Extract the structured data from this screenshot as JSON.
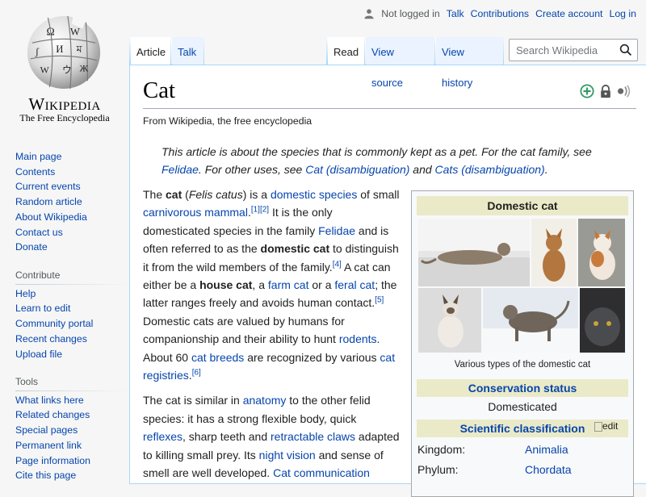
{
  "branding": {
    "wordmark": "Wikipedia",
    "tagline": "The Free Encyclopedia"
  },
  "personal": {
    "not_logged_in": "Not logged in",
    "talk": "Talk",
    "contributions": "Contributions",
    "create_account": "Create account",
    "log_in": "Log in"
  },
  "tabs": {
    "article": "Article",
    "talk": "Talk",
    "read": "Read",
    "view_source": "View source",
    "view_history": "View history"
  },
  "search": {
    "placeholder": "Search Wikipedia"
  },
  "nav": {
    "main": [
      "Main page",
      "Contents",
      "Current events",
      "Random article",
      "About Wikipedia",
      "Contact us",
      "Donate"
    ],
    "contribute_heading": "Contribute",
    "contribute": [
      "Help",
      "Learn to edit",
      "Community portal",
      "Recent changes",
      "Upload file"
    ],
    "tools_heading": "Tools",
    "tools": [
      "What links here",
      "Related changes",
      "Special pages",
      "Permanent link",
      "Page information",
      "Cite this page"
    ]
  },
  "article": {
    "title": "Cat",
    "from": "From Wikipedia, the free encyclopedia",
    "hatnote": {
      "t1": "This article is about the species that is commonly kept as a pet. For the cat family, see ",
      "l1": "Felidae",
      "t2": ". For other uses, see ",
      "l2": "Cat (disambiguation)",
      "t3": " and ",
      "l3": "Cats (disambiguation)",
      "t4": "."
    },
    "p1": {
      "s1": "The ",
      "b1": "cat",
      "s2": " (",
      "i1": "Felis catus",
      "s3": ") is a ",
      "l1": "domestic species",
      "s4": " of small ",
      "l2": "carnivorous mammal",
      "s5": ".",
      "r1": "[1]",
      "r2": "[2]",
      "s6": " It is the only domesticated species in the family ",
      "l3": "Felidae",
      "s7": " and is often referred to as the ",
      "b2": "domestic cat",
      "s8": " to distinguish it from the wild members of the family.",
      "r3": "[4]",
      "s9": " A cat can either be a ",
      "b3": "house cat",
      "s10": ", a ",
      "l4": "farm cat",
      "s11": " or a ",
      "l5": "feral cat",
      "s12": "; the latter ranges freely and avoids human contact.",
      "r4": "[5]",
      "s13": " Domestic cats are valued by humans for companionship and their ability to hunt ",
      "l6": "rodents",
      "s14": ". About 60 ",
      "l7": "cat breeds",
      "s15": " are recognized by various ",
      "l8": "cat registries",
      "s16": ".",
      "r5": "[6]"
    },
    "p2": {
      "s1": "The cat is similar in ",
      "l1": "anatomy",
      "s2": " to the other felid species: it has a strong flexible body, quick ",
      "l2": "reflexes",
      "s3": ", sharp teeth and ",
      "l3": "retractable claws",
      "s4": " adapted to killing small prey. Its ",
      "l4": "night vision",
      "s5": " and sense of smell are well developed. ",
      "l5": "Cat communication"
    }
  },
  "infobox": {
    "title": "Domestic cat",
    "image_caption": "Various types of the domestic cat",
    "conservation_heading": "Conservation status",
    "conservation_value": "Domesticated",
    "classification_heading": "Scientific classification",
    "edit_label": "edit",
    "rows": [
      {
        "label": "Kingdom:",
        "value": "Animalia"
      },
      {
        "label": "Phylum:",
        "value": "Chordata"
      }
    ]
  },
  "colors": {
    "link": "#0645ad",
    "infobox_band": "#ebeac8",
    "tab_border": "#a7d7f9"
  }
}
